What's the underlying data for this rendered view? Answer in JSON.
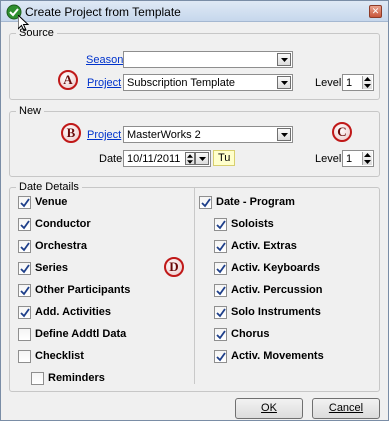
{
  "window": {
    "title": "Create Project from Template",
    "close_glyph": "✕"
  },
  "source": {
    "legend": "Source",
    "season_label": "Season",
    "season_value": "",
    "project_label": "Project",
    "project_value": "Subscription Template",
    "level_label": "Level",
    "level_value": "1",
    "badge": "A"
  },
  "new": {
    "legend": "New",
    "project_label": "Project",
    "project_value": "MasterWorks  2",
    "date_label": "Date",
    "date_value": "10/11/2011",
    "day_value": "Tu",
    "level_label": "Level",
    "level_value": "1",
    "badge_b": "B",
    "badge_c": "C"
  },
  "details": {
    "legend": "Date Details",
    "badge": "D",
    "left": [
      {
        "label": "Venue",
        "checked": true
      },
      {
        "label": "Conductor",
        "checked": true
      },
      {
        "label": "Orchestra",
        "checked": true
      },
      {
        "label": "Series",
        "checked": true
      },
      {
        "label": "Other Participants",
        "checked": true
      },
      {
        "label": "Add. Activities",
        "checked": true
      },
      {
        "label": "Define Addtl Data",
        "checked": false
      },
      {
        "label": "Checklist",
        "checked": false
      },
      {
        "label": "Reminders",
        "checked": false
      }
    ],
    "right": [
      {
        "label": "Date - Program",
        "checked": true
      },
      {
        "label": "Soloists",
        "checked": true
      },
      {
        "label": "Activ. Extras",
        "checked": true
      },
      {
        "label": "Activ. Keyboards",
        "checked": true
      },
      {
        "label": "Activ. Percussion",
        "checked": true
      },
      {
        "label": "Solo Instruments",
        "checked": true
      },
      {
        "label": "Chorus",
        "checked": true
      },
      {
        "label": "Activ. Movements",
        "checked": true
      }
    ]
  },
  "buttons": {
    "ok": "OK",
    "cancel": "Cancel"
  },
  "colors": {
    "link": "#0033cc",
    "badge_border": "#c01818",
    "day_bg": "#ffffcc"
  }
}
